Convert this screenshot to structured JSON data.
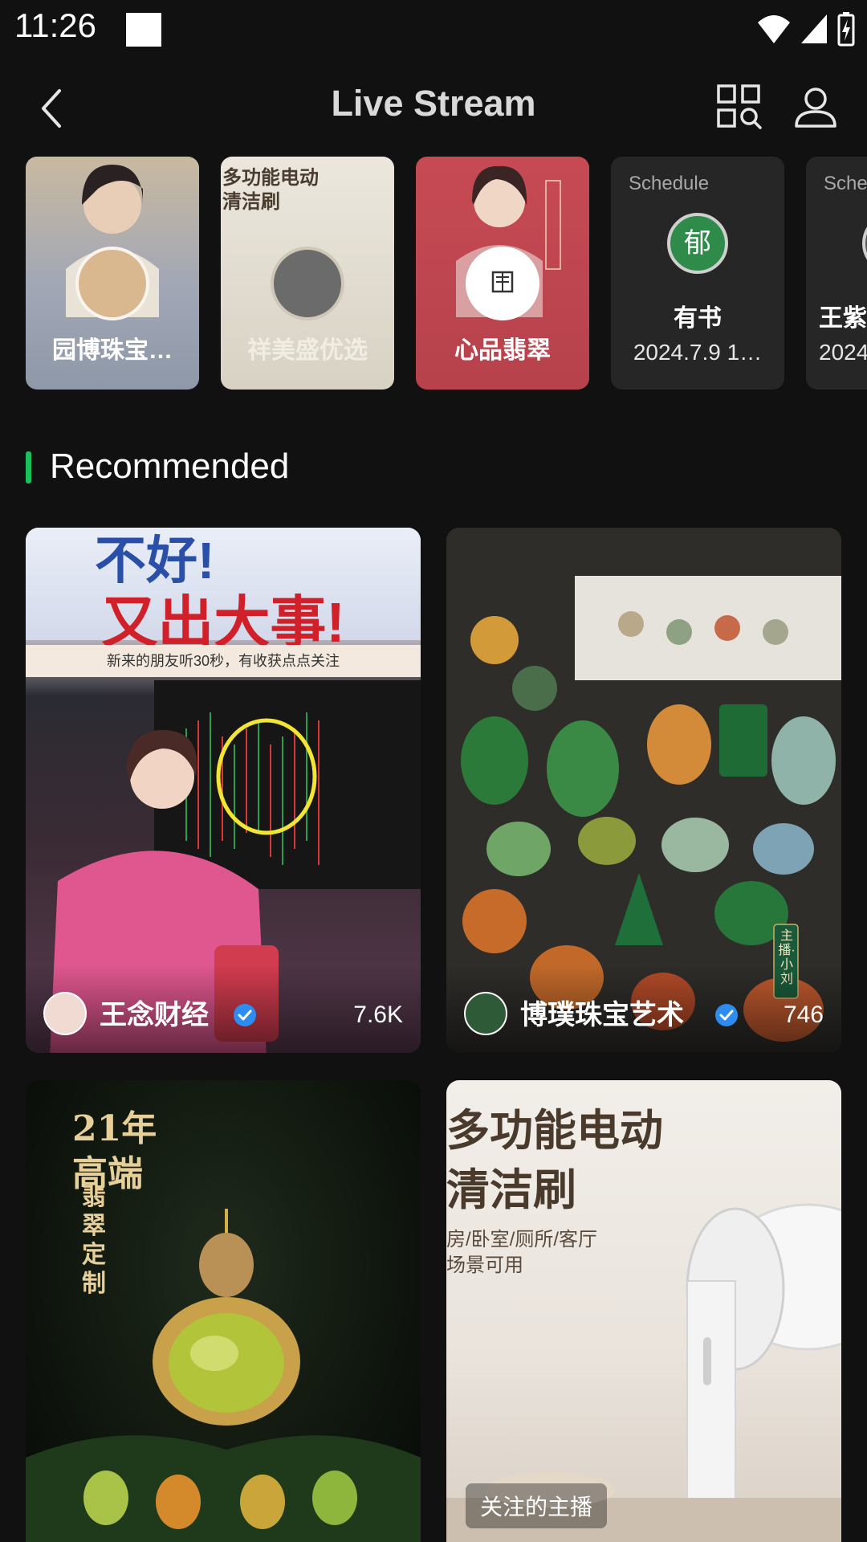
{
  "status_bar": {
    "time": "11:26"
  },
  "header": {
    "title": "Live Stream"
  },
  "stories": [
    {
      "label": "园博珠宝…"
    },
    {
      "label": "祥美盛优选",
      "poster_text_1": "多功能电动",
      "poster_text_2": "清洁刷"
    },
    {
      "label": "心品翡翠"
    },
    {
      "type": "schedule",
      "schedule_label": "Schedule",
      "avatar_text": "郁",
      "name": "有书",
      "date": "2024.7.9 1…"
    },
    {
      "type": "schedule",
      "schedule_label": "Sche",
      "name": "王紫",
      "date": "2024"
    }
  ],
  "section": {
    "title": "Recommended"
  },
  "cards": [
    {
      "host": "王念财经",
      "viewers": "7.6K",
      "headline_1": "不好!",
      "headline_2": "又出大事!",
      "subline": "新来的朋友听30秒，有收获点点关注"
    },
    {
      "host": "博璞珠宝艺术",
      "viewers": "746",
      "tag": "主播·小刘"
    },
    {
      "poster_line_1": "21年",
      "poster_line_2": "高端",
      "poster_line_3": "翡翠定制"
    },
    {
      "poster_line_1": "多功能电动",
      "poster_line_2": "清洁刷",
      "poster_line_3": "房/卧室/厕所/客厅",
      "poster_line_4": "场景可用",
      "follow_tag": "关注的主播"
    }
  ],
  "colors": {
    "accent": "#19c15b",
    "background": "#111111",
    "verified": "#2d8cf0"
  }
}
